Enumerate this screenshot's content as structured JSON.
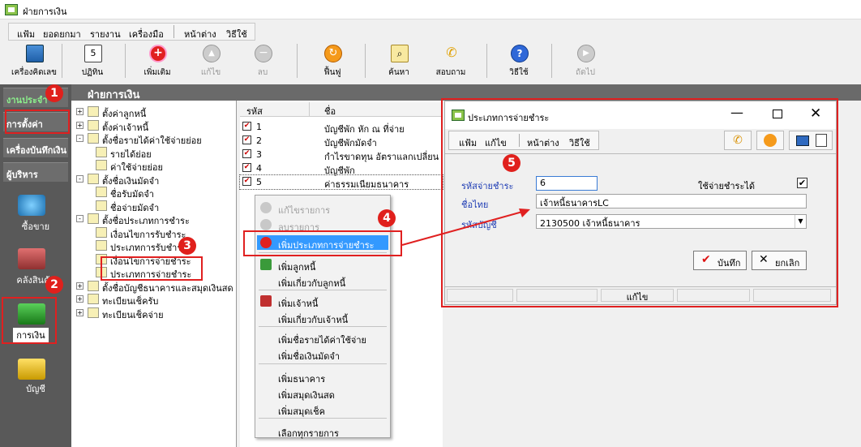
{
  "window": {
    "title": "ฝ่ายการเงิน"
  },
  "menu": [
    "แฟ้ม",
    "ยอดยกมา",
    "รายงาน",
    "เครื่องมือ",
    "หน้าต่าง",
    "วิธีใช้"
  ],
  "toolbar": [
    {
      "label": "เครื่องคิดเลข",
      "icon": "calculator-icon",
      "enabled": true
    },
    {
      "label": "ปฏิทิน",
      "icon": "calendar-icon",
      "enabled": true
    },
    {
      "label": "เพิ่มเติม",
      "icon": "add-icon",
      "enabled": true
    },
    {
      "label": "แก้ไข",
      "icon": "up-icon",
      "enabled": false
    },
    {
      "label": "ลบ",
      "icon": "minus-icon",
      "enabled": false
    },
    {
      "label": "ฟื้นฟู",
      "icon": "refresh-icon",
      "enabled": true
    },
    {
      "label": "ค้นหา",
      "icon": "search-icon",
      "enabled": true
    },
    {
      "label": "สอบถาม",
      "icon": "phone-icon",
      "enabled": true
    },
    {
      "label": "วิธีใช้",
      "icon": "help-icon",
      "enabled": true
    },
    {
      "label": "ถัดไป",
      "icon": "next-icon",
      "enabled": false
    }
  ],
  "sidebar": {
    "buttons": [
      "งานประจำ",
      "การตั้งค่า",
      "เครื่องบันทึกเงิน",
      "ผู้บริหาร"
    ],
    "modules": [
      "ซื้อขาย",
      "คลังสินค้า",
      "การเงิน",
      "บัญชี"
    ]
  },
  "header": "ฝ่ายการเงิน",
  "tree": [
    {
      "label": "ตั้งค่าลูกหนี้",
      "level": 0,
      "expander": "+"
    },
    {
      "label": "ตั้งค่าเจ้าหนี้",
      "level": 0,
      "expander": "+"
    },
    {
      "label": "ตั้งชื่อรายได้ค่าใช้จ่ายย่อย",
      "level": 0,
      "expander": "-"
    },
    {
      "label": "รายได้ย่อย",
      "level": 1,
      "expander": ""
    },
    {
      "label": "ค่าใช้จ่ายย่อย",
      "level": 1,
      "expander": ""
    },
    {
      "label": "ตั้งชื่อเงินมัดจำ",
      "level": 0,
      "expander": "-"
    },
    {
      "label": "ชื่อรับมัดจำ",
      "level": 1,
      "expander": ""
    },
    {
      "label": "ชื่อจ่ายมัดจำ",
      "level": 1,
      "expander": ""
    },
    {
      "label": "ตั้งชื่อประเภทการชำระ",
      "level": 0,
      "expander": "-"
    },
    {
      "label": "เงื่อนไขการรับชำระ",
      "level": 1,
      "expander": ""
    },
    {
      "label": "ประเภทการรับชำระ",
      "level": 1,
      "expander": ""
    },
    {
      "label": "เงื่อนไขการจ่ายชำระ",
      "level": 1,
      "expander": ""
    },
    {
      "label": "ประเภทการจ่ายชำระ",
      "level": 1,
      "expander": ""
    },
    {
      "label": "ตั้งชื่อบัญชีธนาคารและสมุดเงินสด",
      "level": 0,
      "expander": "+"
    },
    {
      "label": "ทะเบียนเช็ครับ",
      "level": 0,
      "expander": "+"
    },
    {
      "label": "ทะเบียนเช็คจ่าย",
      "level": 0,
      "expander": "+"
    }
  ],
  "list": {
    "columns": [
      "รหัส",
      "ชื่อ"
    ],
    "rows": [
      {
        "code": "1",
        "name": "บัญชีพัก หัก ณ ที่จ่าย"
      },
      {
        "code": "2",
        "name": "บัญชีพักมัดจำ"
      },
      {
        "code": "3",
        "name": "กำไรขาดทุน อัตราแลกเปลี่ยน"
      },
      {
        "code": "4",
        "name": "บัญชีพัก"
      },
      {
        "code": "5",
        "name": "ค่าธรรมเนียมธนาคาร"
      }
    ]
  },
  "context_menu": [
    {
      "label": "แก้ไขรายการ",
      "enabled": false,
      "icon": "up-icon"
    },
    {
      "label": "ลบรายการ",
      "enabled": false,
      "icon": "minus-icon"
    },
    {
      "label": "เพิ่มประเภทการจ่ายชำระ",
      "enabled": true,
      "icon": "add-icon",
      "highlight": true
    },
    {
      "label": "เพิ่มลูกหนี้",
      "enabled": true,
      "icon": "debtor-icon"
    },
    {
      "label": "เพิ่มเกี่ยวกับลูกหนี้",
      "enabled": true
    },
    {
      "label": "เพิ่มเจ้าหนี้",
      "enabled": true,
      "icon": "creditor-icon"
    },
    {
      "label": "เพิ่มเกี่ยวกับเจ้าหนี้",
      "enabled": true
    },
    {
      "label": "เพิ่มชื่อรายได้ค่าใช้จ่าย",
      "enabled": true
    },
    {
      "label": "เพิ่มชื่อเงินมัดจำ",
      "enabled": true
    },
    {
      "label": "เพิ่มธนาคาร",
      "enabled": true
    },
    {
      "label": "เพิ่มสมุดเงินสด",
      "enabled": true
    },
    {
      "label": "เพิ่มสมุดเช็ค",
      "enabled": true
    },
    {
      "label": "เลือกทุกรายการ",
      "enabled": true
    }
  ],
  "dialog": {
    "title": "ประเภทการจ่ายชำระ",
    "menu": [
      "แฟ้ม",
      "แก้ไข",
      "หน้าต่าง",
      "วิธีใช้"
    ],
    "fields": {
      "code_label": "รหัสจ่ายชำระ",
      "code_value": "6",
      "usable_label": "ใช้จ่ายชำระได้",
      "usable_checked": "✔",
      "name_label": "ชื่อไทย",
      "name_value": "เจ้าหนี้ธนาคารLC",
      "account_label": "รหัสบัญชี",
      "account_value": "2130500 เจ้าหนี้ธนาคาร"
    },
    "save_label": "บันทึก",
    "cancel_label": "ยกเลิก",
    "status": "แก้ไข"
  },
  "annotations": [
    "1",
    "2",
    "3",
    "4",
    "5"
  ],
  "colors": {
    "annotation": "#e0201c",
    "highlight": "#3399ff",
    "label_blue": "#1e3cb4"
  }
}
